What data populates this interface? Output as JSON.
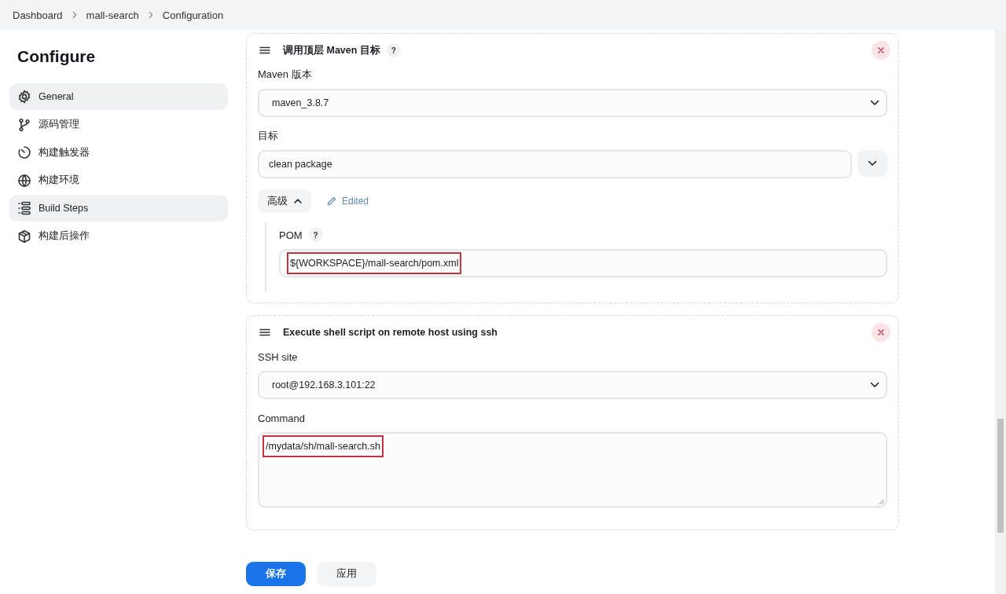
{
  "breadcrumbs": [
    {
      "label": "Dashboard"
    },
    {
      "label": "mall-search"
    },
    {
      "label": "Configuration"
    }
  ],
  "sidebar": {
    "title": "Configure",
    "items": [
      {
        "label": "General",
        "selected": true
      },
      {
        "label": "源码管理",
        "selected": false
      },
      {
        "label": "构建触发器",
        "selected": false
      },
      {
        "label": "构建环境",
        "selected": false
      },
      {
        "label": "Build Steps",
        "selected": true
      },
      {
        "label": "构建后操作",
        "selected": false
      }
    ]
  },
  "steps": [
    {
      "title": "调用顶层 Maven 目标",
      "help": "?",
      "fields": [
        {
          "kind": "select",
          "label": "Maven 版本",
          "value": "maven_3.8.7"
        },
        {
          "kind": "combo",
          "label": "目标",
          "value": "clean package"
        }
      ],
      "advanced": {
        "label": "高级",
        "expanded": true,
        "edited": "Edited",
        "fields": [
          {
            "kind": "text",
            "label": "POM",
            "help": "?",
            "value": "${WORKSPACE}/mall-search/pom.xml",
            "highlighted": true
          }
        ]
      }
    },
    {
      "title": "Execute shell script on remote host using ssh",
      "fields": [
        {
          "kind": "select",
          "label": "SSH site",
          "value": "root@192.168.3.101:22"
        },
        {
          "kind": "textarea",
          "label": "Command",
          "value": "/mydata/sh/mall-search.sh",
          "highlighted": true
        }
      ]
    }
  ],
  "actions": [
    {
      "label": "保存",
      "kind": "primary"
    },
    {
      "label": "应用",
      "kind": "secondary"
    }
  ]
}
